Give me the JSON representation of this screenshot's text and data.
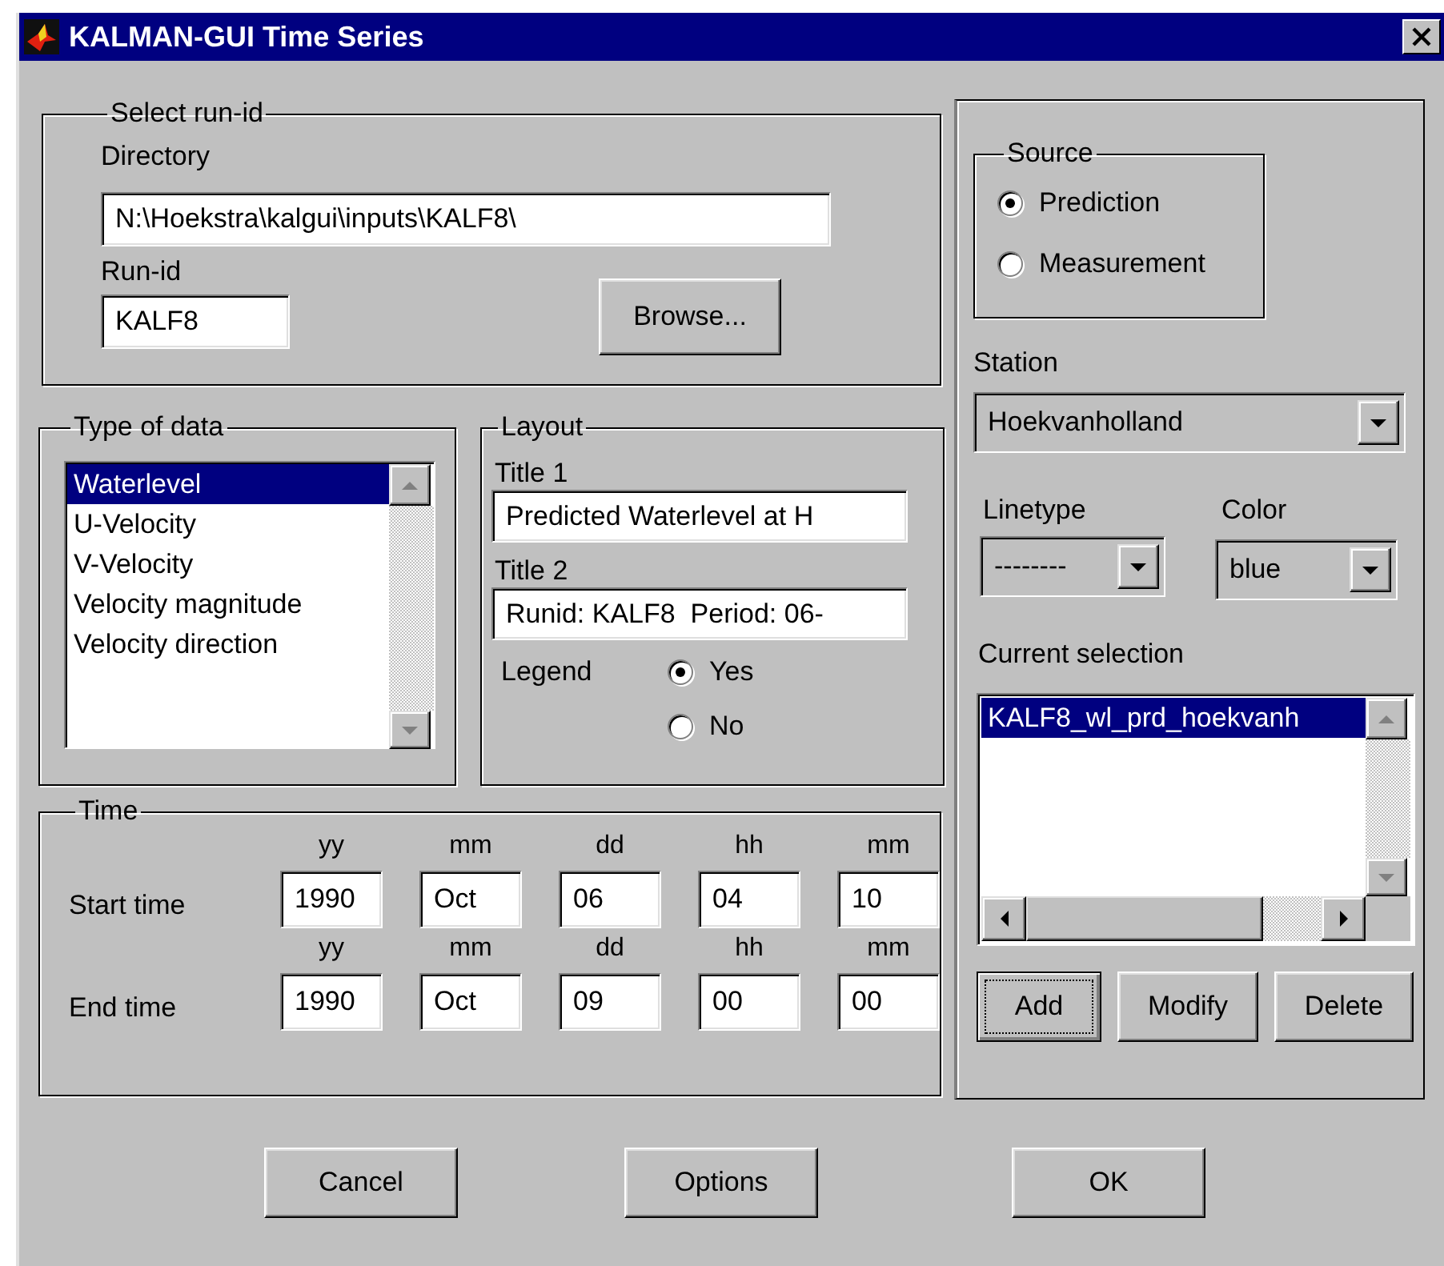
{
  "window": {
    "title": "KALMAN-GUI Time Series"
  },
  "run_id": {
    "legend": "Select run-id",
    "directory_label": "Directory",
    "directory": "N:\\Hoekstra\\kalgui\\inputs\\KALF8\\",
    "run_id_label": "Run-id",
    "run_id": "KALF8",
    "browse": "Browse..."
  },
  "type_of_data": {
    "legend": "Type of data",
    "items": [
      {
        "label": "Waterlevel",
        "selected": true
      },
      {
        "label": "U-Velocity",
        "selected": false
      },
      {
        "label": "V-Velocity",
        "selected": false
      },
      {
        "label": "Velocity magnitude",
        "selected": false
      },
      {
        "label": "Velocity direction",
        "selected": false
      }
    ]
  },
  "layout": {
    "legend": "Layout",
    "title1_label": "Title 1",
    "title1": "Predicted Waterlevel at H",
    "title2_label": "Title 2",
    "title2": "Runid: KALF8  Period: 06-",
    "legend_label": "Legend",
    "legend_options": [
      {
        "label": "Yes",
        "selected": true
      },
      {
        "label": "No",
        "selected": false
      }
    ]
  },
  "time": {
    "legend": "Time",
    "rows": [
      {
        "label": "Start time",
        "fields": [
          {
            "unit": "yy",
            "value": "1990"
          },
          {
            "unit": "mm",
            "value": "Oct"
          },
          {
            "unit": "dd",
            "value": "06"
          },
          {
            "unit": "hh",
            "value": "04"
          },
          {
            "unit": "mm",
            "value": "10"
          }
        ]
      },
      {
        "label": "End time",
        "fields": [
          {
            "unit": "yy",
            "value": "1990"
          },
          {
            "unit": "mm",
            "value": "Oct"
          },
          {
            "unit": "dd",
            "value": "09"
          },
          {
            "unit": "hh",
            "value": "00"
          },
          {
            "unit": "mm",
            "value": "00"
          }
        ]
      }
    ]
  },
  "source": {
    "legend": "Source",
    "options": [
      {
        "label": "Prediction",
        "selected": true
      },
      {
        "label": "Measurement",
        "selected": false
      }
    ]
  },
  "station": {
    "label": "Station",
    "value": "Hoekvanholland"
  },
  "linetype": {
    "label": "Linetype",
    "value": "--------"
  },
  "color": {
    "label": "Color",
    "value": "blue"
  },
  "current_selection": {
    "label": "Current selection",
    "items": [
      {
        "label": "KALF8_wl_prd_hoekvanh",
        "selected": true
      }
    ]
  },
  "selection_buttons": [
    {
      "label": "Add",
      "focused": true
    },
    {
      "label": "Modify",
      "focused": false
    },
    {
      "label": "Delete",
      "focused": false
    }
  ],
  "buttons": [
    "Cancel",
    "Options",
    "OK"
  ]
}
